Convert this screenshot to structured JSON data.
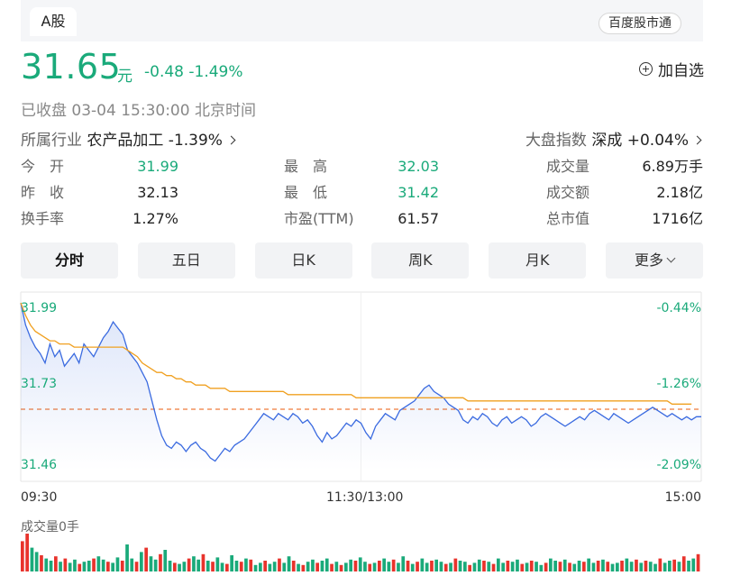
{
  "header": {
    "tab_label": "A股",
    "source_pill": "百度股市通"
  },
  "quote": {
    "price": "31.65",
    "unit": "元",
    "change": "-0.48 -1.49%",
    "add_watch": "加自选",
    "status": "已收盘  03-04 15:30:00  北京时间",
    "industry_label": "所属行业",
    "industry_value": "农产品加工 -1.39%",
    "index_label": "大盘指数",
    "index_value": "深成 +0.04%"
  },
  "stats": {
    "open_label": "今　开",
    "open": "31.99",
    "prev_label": "昨　收",
    "prev": "32.13",
    "turnover_label": "换手率",
    "turnover": "1.27%",
    "high_label": "最　高",
    "high": "32.03",
    "low_label": "最　低",
    "low": "31.42",
    "pe_label": "市盈(TTM)",
    "pe": "61.57",
    "vol_label": "成交量",
    "vol": "6.89万手",
    "amount_label": "成交额",
    "amount": "2.18亿",
    "mcap_label": "总市值",
    "mcap": "1716亿"
  },
  "periods": [
    "分时",
    "五日",
    "日K",
    "周K",
    "月K",
    "更多"
  ],
  "colors": {
    "up": "#e8332c",
    "down": "#1aaa7a",
    "price_line": "#3b6be0",
    "avg_line": "#f0a020",
    "prev_close": "#ef7b3a"
  },
  "chart_data": {
    "type": "line",
    "y_left_ticks": [
      "31.99",
      "31.73",
      "31.46"
    ],
    "y_right_ticks": [
      "-0.44%",
      "-1.26%",
      "-2.09%"
    ],
    "x_ticks": [
      "09:30",
      "11:30/13:00",
      "15:00"
    ],
    "ylim": [
      31.46,
      31.99
    ],
    "prev_close": 32.13,
    "volume_label": "成交量0手",
    "price": [
      31.99,
      31.92,
      31.88,
      31.85,
      31.83,
      31.8,
      31.86,
      31.82,
      31.84,
      31.79,
      31.81,
      31.83,
      31.8,
      31.86,
      31.84,
      31.82,
      31.85,
      31.88,
      31.9,
      31.93,
      31.91,
      31.89,
      31.84,
      31.82,
      31.8,
      31.77,
      31.74,
      31.68,
      31.62,
      31.57,
      31.54,
      31.53,
      31.55,
      31.54,
      31.52,
      31.54,
      31.55,
      31.53,
      31.52,
      31.5,
      31.49,
      31.51,
      31.53,
      31.52,
      31.54,
      31.55,
      31.56,
      31.58,
      31.6,
      31.62,
      31.64,
      31.63,
      31.62,
      31.64,
      31.63,
      31.62,
      31.64,
      31.63,
      31.61,
      31.62,
      31.6,
      31.57,
      31.55,
      31.58,
      31.56,
      31.57,
      31.59,
      31.61,
      31.6,
      31.62,
      31.61,
      31.58,
      31.56,
      31.6,
      31.62,
      31.64,
      31.63,
      31.62,
      31.65,
      31.66,
      31.67,
      31.68,
      31.7,
      31.72,
      31.73,
      31.71,
      31.7,
      31.69,
      31.67,
      31.66,
      31.65,
      31.62,
      31.61,
      31.63,
      31.62,
      31.64,
      31.63,
      31.61,
      31.6,
      31.62,
      31.63,
      31.61,
      31.62,
      31.63,
      31.62,
      31.6,
      31.61,
      31.63,
      31.64,
      31.63,
      31.62,
      31.61,
      31.6,
      31.61,
      31.62,
      31.63,
      31.62,
      31.64,
      31.65,
      31.64,
      31.63,
      31.62,
      31.64,
      31.63,
      31.62,
      31.61,
      31.62,
      31.63,
      31.64,
      31.65,
      31.66,
      31.65,
      31.64,
      31.63,
      31.64,
      31.63,
      31.62,
      31.63,
      31.62,
      31.63,
      31.63
    ],
    "avg": [
      31.99,
      31.95,
      31.92,
      31.9,
      31.89,
      31.88,
      31.87,
      31.87,
      31.86,
      31.86,
      31.86,
      31.85,
      31.85,
      31.85,
      31.85,
      31.85,
      31.85,
      31.85,
      31.85,
      31.85,
      31.85,
      31.85,
      31.84,
      31.83,
      31.82,
      31.8,
      31.79,
      31.78,
      31.77,
      31.77,
      31.76,
      31.76,
      31.75,
      31.75,
      31.74,
      31.74,
      31.73,
      31.73,
      31.73,
      31.72,
      31.72,
      31.72,
      31.72,
      31.71,
      31.71,
      31.71,
      31.71,
      31.71,
      31.71,
      31.71,
      31.71,
      31.71,
      31.71,
      31.71,
      31.71,
      31.7,
      31.7,
      31.7,
      31.7,
      31.7,
      31.7,
      31.7,
      31.7,
      31.7,
      31.7,
      31.7,
      31.7,
      31.7,
      31.7,
      31.69,
      31.69,
      31.69,
      31.69,
      31.69,
      31.69,
      31.69,
      31.69,
      31.69,
      31.69,
      31.69,
      31.69,
      31.69,
      31.69,
      31.69,
      31.69,
      31.69,
      31.69,
      31.69,
      31.69,
      31.69,
      31.69,
      31.69,
      31.68,
      31.68,
      31.68,
      31.68,
      31.68,
      31.68,
      31.68,
      31.68,
      31.68,
      31.68,
      31.68,
      31.68,
      31.68,
      31.68,
      31.68,
      31.68,
      31.68,
      31.68,
      31.68,
      31.68,
      31.68,
      31.68,
      31.68,
      31.68,
      31.68,
      31.68,
      31.68,
      31.68,
      31.68,
      31.68,
      31.68,
      31.68,
      31.68,
      31.68,
      31.68,
      31.68,
      31.68,
      31.68,
      31.68,
      31.68,
      31.68,
      31.68,
      31.67,
      31.67,
      31.67,
      31.67,
      31.67
    ],
    "volume": [
      28,
      35,
      22,
      18,
      15,
      12,
      10,
      14,
      9,
      12,
      8,
      11,
      7,
      9,
      10,
      12,
      14,
      11,
      9,
      8,
      13,
      10,
      25,
      12,
      9,
      18,
      22,
      14,
      11,
      16,
      20,
      10,
      8,
      7,
      9,
      12,
      14,
      11,
      16,
      10,
      9,
      13,
      8,
      7,
      15,
      10,
      9,
      12,
      11,
      6,
      8,
      10,
      7,
      9,
      12,
      8,
      14,
      10,
      7,
      6,
      9,
      11,
      8,
      10,
      12,
      7,
      9,
      6,
      8,
      11,
      10,
      13,
      9,
      7,
      8,
      10,
      12,
      9,
      11,
      8,
      14,
      10,
      7,
      9,
      12,
      8,
      10,
      11,
      9,
      7,
      8,
      12,
      10,
      9,
      6,
      8,
      11,
      10,
      9,
      7,
      12,
      8,
      10,
      9,
      11,
      7,
      8,
      10,
      9,
      6,
      8,
      12,
      10,
      9,
      11,
      8,
      7,
      10,
      9,
      12,
      8,
      10,
      11,
      9,
      7,
      8,
      10,
      12,
      9,
      11,
      8,
      10,
      9,
      7,
      12,
      8,
      10,
      11,
      9,
      14,
      10,
      12,
      16
    ],
    "volume_colors_up": [
      1,
      1,
      0,
      0,
      1,
      0,
      0,
      1,
      0,
      1,
      0,
      0,
      1,
      0,
      0,
      1,
      0,
      0,
      1,
      0,
      0,
      1,
      0,
      0,
      1,
      0,
      1,
      0,
      0,
      1,
      0,
      0,
      1,
      0,
      0,
      1,
      0,
      0,
      1,
      0,
      1,
      0,
      0,
      1,
      0,
      0,
      1,
      0,
      1,
      0,
      0,
      1,
      0,
      0,
      1,
      0,
      0,
      1,
      0,
      1,
      0,
      0,
      1,
      0,
      0,
      1,
      0,
      1,
      0,
      0,
      1,
      0,
      0,
      1,
      0,
      1,
      0,
      0,
      1,
      0,
      0,
      1,
      0,
      1,
      0,
      0,
      1,
      0,
      0,
      1,
      0,
      1,
      0,
      0,
      1,
      0,
      0,
      1,
      0,
      1,
      0,
      0,
      1,
      0,
      0,
      1,
      0,
      1,
      0,
      0,
      1,
      0,
      0,
      1,
      0,
      1,
      0,
      0,
      1,
      0,
      0,
      1,
      0,
      1,
      0,
      0,
      1,
      0,
      0,
      1,
      0,
      1,
      0,
      0,
      1,
      0,
      0,
      1,
      0,
      1,
      0,
      0,
      1,
      1
    ]
  }
}
